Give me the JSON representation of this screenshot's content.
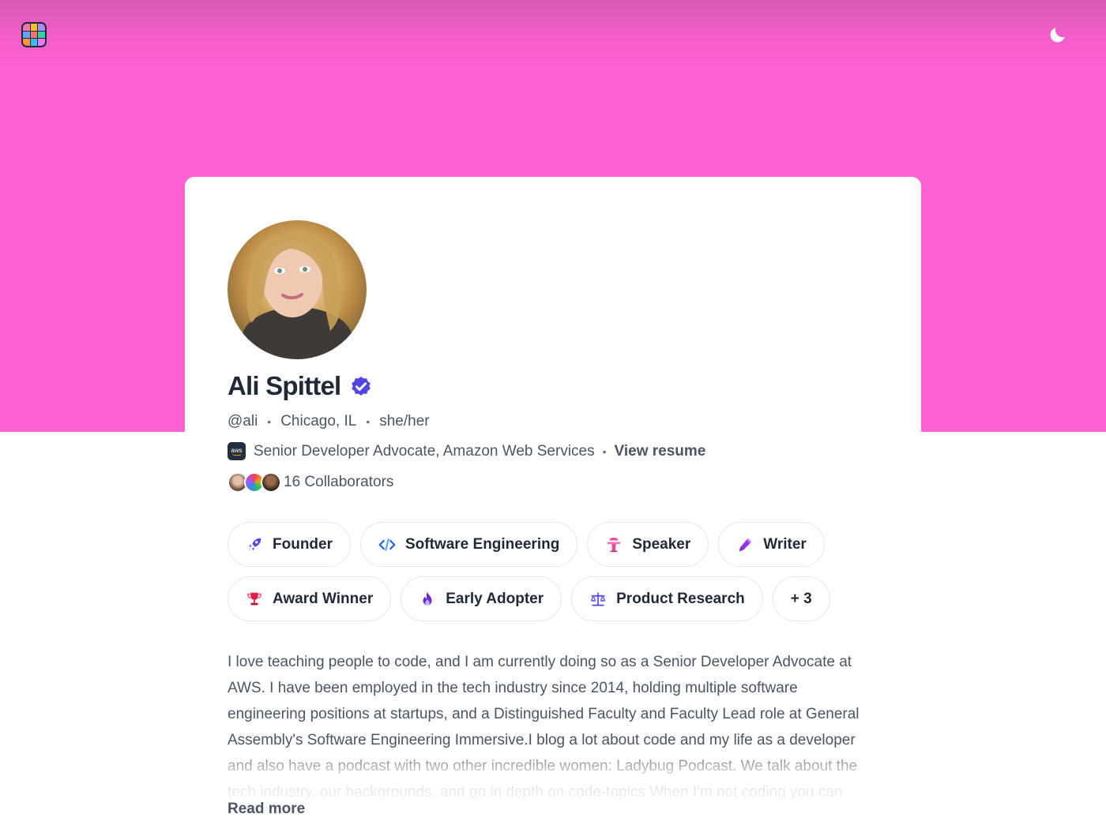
{
  "header": {
    "logo_icon": "grid-logo-icon",
    "theme_toggle_icon": "moon-icon",
    "banner_color": "#ff62d3"
  },
  "profile": {
    "name": "Ali Spittel",
    "verified_icon": "verified-badge-icon",
    "handle": "@ali",
    "location": "Chicago, IL",
    "pronouns": "she/her",
    "job_title": "Senior Developer Advocate, Amazon Web Services",
    "company_logo_text": "aws",
    "view_resume": "View resume",
    "collaborators": "16 Collaborators"
  },
  "tags": [
    {
      "label": "Founder",
      "icon": "rocket-icon",
      "color": "#4f46e5"
    },
    {
      "label": "Software Engineering",
      "icon": "code-icon",
      "color": "#2563eb"
    },
    {
      "label": "Speaker",
      "icon": "podium-icon",
      "color": "#ec4899"
    },
    {
      "label": "Writer",
      "icon": "pen-icon",
      "color": "#9333ea"
    },
    {
      "label": "Award Winner",
      "icon": "trophy-icon",
      "color": "#e11d48"
    },
    {
      "label": "Early Adopter",
      "icon": "flame-icon",
      "color": "#6d28d9"
    },
    {
      "label": "Product Research",
      "icon": "scale-icon",
      "color": "#4f46e5"
    },
    {
      "label": "+ 3",
      "icon": "",
      "color": ""
    }
  ],
  "bio": {
    "text": "I love teaching people to code, and I am currently doing so as a Senior Developer Advocate at AWS. I have been employed in the tech industry since 2014, holding multiple software engineering positions at startups, and a Distinguished Faculty and Faculty Lead role at General Assembly's Software Engineering Immersive.I blog a lot about code and my life as a developer and also have a podcast with two other incredible women: Ladybug Podcast. We talk about the tech industry, our backgrounds, and go in depth on code-topics When I'm not coding you can",
    "read_more": "Read more"
  }
}
